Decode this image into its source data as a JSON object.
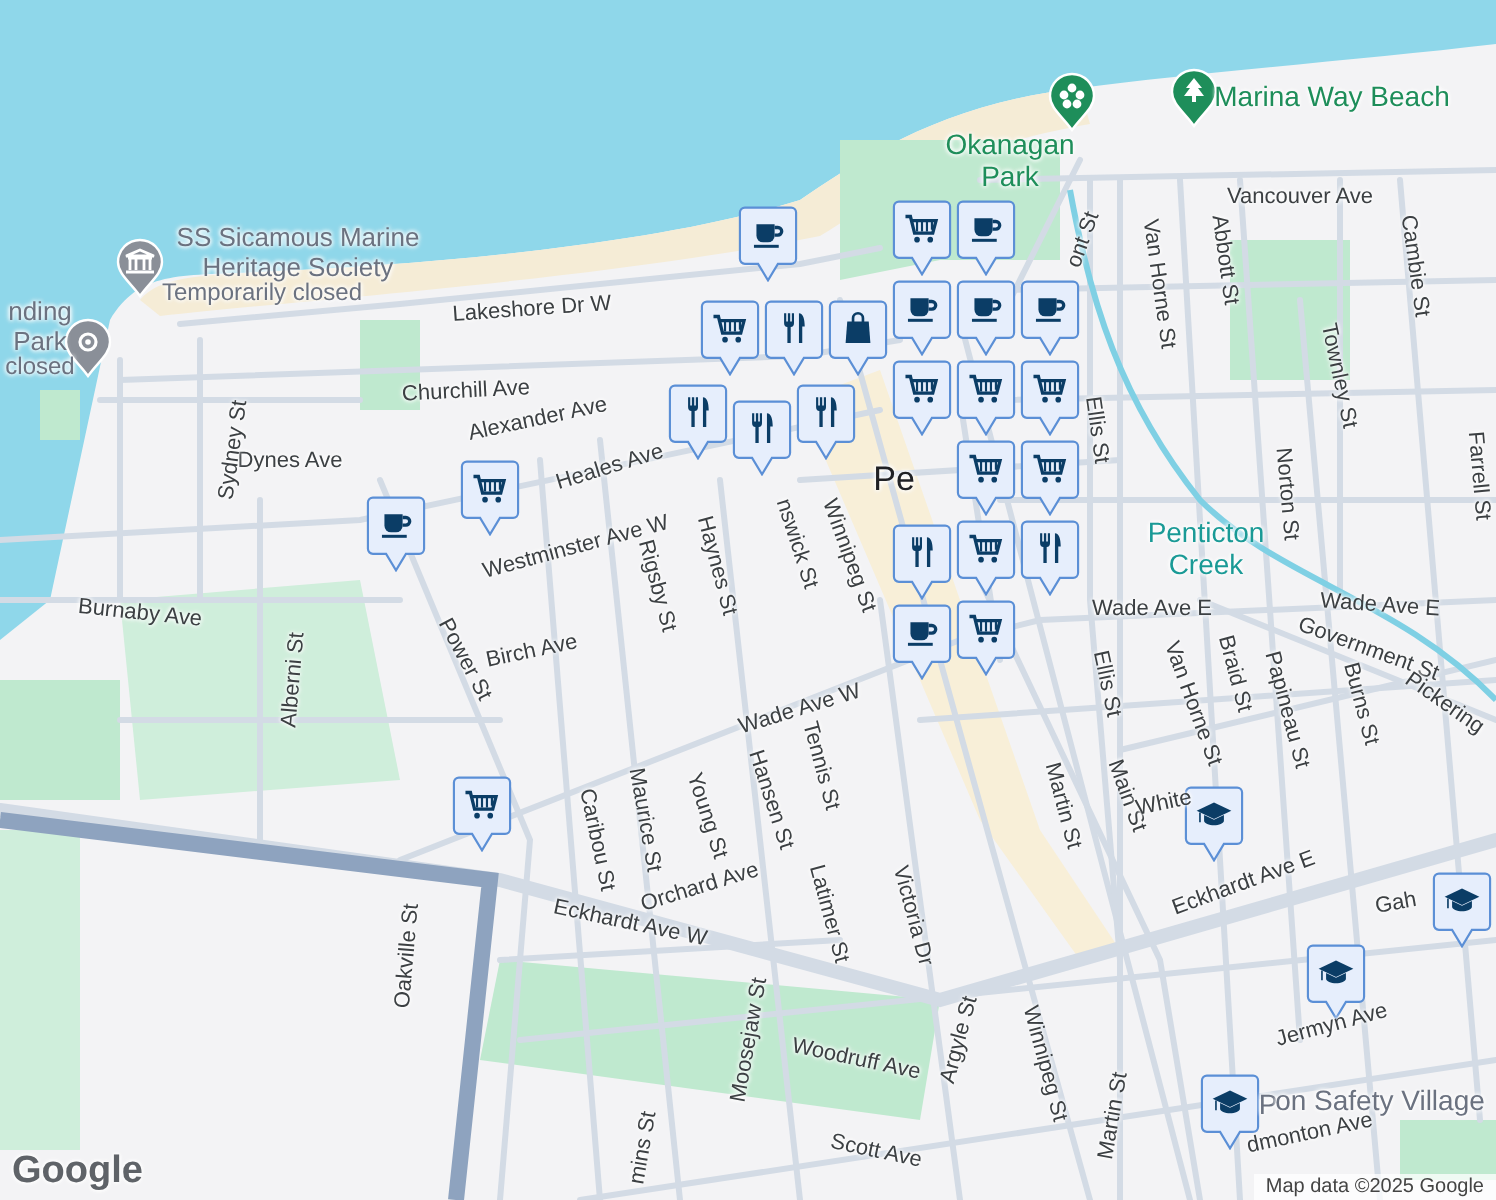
{
  "labels": [
    {
      "text": "Lakeshore Dr W",
      "kind": "street"
    },
    {
      "text": "Churchill Ave",
      "kind": "street"
    },
    {
      "text": "Alexander Ave",
      "kind": "street"
    },
    {
      "text": "Heales Ave",
      "kind": "street"
    },
    {
      "text": "Dynes Ave",
      "kind": "street"
    },
    {
      "text": "Sydney St",
      "kind": "street"
    },
    {
      "text": "Westminster Ave W",
      "kind": "street"
    },
    {
      "text": "Rigsby St",
      "kind": "street"
    },
    {
      "text": "Haynes St",
      "kind": "street"
    },
    {
      "text": "nswick St",
      "kind": "street"
    },
    {
      "text": "Winnipeg St",
      "kind": "street"
    },
    {
      "text": "Burnaby Ave",
      "kind": "street"
    },
    {
      "text": "Birch Ave",
      "kind": "street"
    },
    {
      "text": "Power St",
      "kind": "street"
    },
    {
      "text": "Alberni St",
      "kind": "street"
    },
    {
      "text": "Wade Ave W",
      "kind": "street"
    },
    {
      "text": "Maurice St",
      "kind": "street"
    },
    {
      "text": "Young St",
      "kind": "street"
    },
    {
      "text": "Hansen St",
      "kind": "street"
    },
    {
      "text": "Tennis St",
      "kind": "street"
    },
    {
      "text": "Caribou St",
      "kind": "street"
    },
    {
      "text": "Orchard Ave",
      "kind": "street"
    },
    {
      "text": "Latimer St",
      "kind": "street"
    },
    {
      "text": "Victoria Dr",
      "kind": "street"
    },
    {
      "text": "Eckhardt Ave W",
      "kind": "street"
    },
    {
      "text": "Oakville St",
      "kind": "street"
    },
    {
      "text": "Woodruff Ave",
      "kind": "street"
    },
    {
      "text": "Moosejaw St",
      "kind": "street"
    },
    {
      "text": "Argyle St",
      "kind": "street"
    },
    {
      "text": "Winnipeg St",
      "kind": "street"
    },
    {
      "text": "Martin St",
      "kind": "street"
    },
    {
      "text": "Main St",
      "kind": "street"
    },
    {
      "text": "Martin St",
      "kind": "street"
    },
    {
      "text": "Scott Ave",
      "kind": "street"
    },
    {
      "text": "mins St",
      "kind": "street"
    },
    {
      "text": "Eckhardt Ave E",
      "kind": "street"
    },
    {
      "text": "White",
      "kind": "street"
    },
    {
      "text": "Ellis St",
      "kind": "street"
    },
    {
      "text": "Van Horne St",
      "kind": "street"
    },
    {
      "text": "Braid St",
      "kind": "street"
    },
    {
      "text": "Papineau St",
      "kind": "street"
    },
    {
      "text": "Burns St",
      "kind": "street"
    },
    {
      "text": "Government St",
      "kind": "street"
    },
    {
      "text": "Pickering",
      "kind": "street"
    },
    {
      "text": "Wade Ave E",
      "kind": "street"
    },
    {
      "text": "Wade Ave E",
      "kind": "street"
    },
    {
      "text": "Ellis St",
      "kind": "street"
    },
    {
      "text": "Van Horne St",
      "kind": "street"
    },
    {
      "text": "Abbott St",
      "kind": "street"
    },
    {
      "text": "Cambie St",
      "kind": "street"
    },
    {
      "text": "Townley St",
      "kind": "street"
    },
    {
      "text": "Norton St",
      "kind": "street"
    },
    {
      "text": "Farrell St",
      "kind": "street"
    },
    {
      "text": "Vancouver Ave",
      "kind": "street"
    },
    {
      "text": "ont St",
      "kind": "street"
    },
    {
      "text": "Jermyn Ave",
      "kind": "street"
    },
    {
      "text": "dmonton Ave",
      "kind": "street"
    },
    {
      "text": "Gah",
      "kind": "street"
    },
    {
      "text": "Pe",
      "kind": "city"
    },
    {
      "text": "Okanagan Park",
      "kind": "park"
    },
    {
      "text": "Marina Way Beach",
      "kind": "park"
    },
    {
      "text": "Penticton Creek",
      "kind": "water"
    },
    {
      "text": "SS Sicamous Marine Heritage Society",
      "kind": "poi"
    },
    {
      "text": "Temporarily closed",
      "kind": "note"
    },
    {
      "text": "nding Park",
      "kind": "poi"
    },
    {
      "text": "closed",
      "kind": "note"
    },
    {
      "text": "P",
      "kind": "poi"
    },
    {
      "text": "on Safety Village",
      "kind": "poi"
    }
  ],
  "pois": [
    {
      "kind": "museum"
    },
    {
      "kind": "landmark"
    },
    {
      "kind": "flower"
    },
    {
      "kind": "tree"
    }
  ],
  "markers": [
    {
      "kind": "cup"
    },
    {
      "kind": "cart"
    },
    {
      "kind": "cup"
    },
    {
      "kind": "cup"
    },
    {
      "kind": "cup"
    },
    {
      "kind": "cutlery"
    },
    {
      "kind": "bag"
    },
    {
      "kind": "cart"
    },
    {
      "kind": "cutlery"
    },
    {
      "kind": "cutlery"
    },
    {
      "kind": "cutlery"
    },
    {
      "kind": "cart"
    },
    {
      "kind": "cup"
    },
    {
      "kind": "cart"
    },
    {
      "kind": "cart"
    },
    {
      "kind": "cart"
    },
    {
      "kind": "cart"
    },
    {
      "kind": "cart"
    },
    {
      "kind": "cart"
    },
    {
      "kind": "cutlery"
    },
    {
      "kind": "cutlery"
    },
    {
      "kind": "cup"
    },
    {
      "kind": "cart"
    },
    {
      "kind": "cup"
    },
    {
      "kind": "cart"
    },
    {
      "kind": "school"
    },
    {
      "kind": "school"
    },
    {
      "kind": "school"
    },
    {
      "kind": "school"
    }
  ],
  "logo": "Google",
  "attribution": "Map data ©2025 Google"
}
